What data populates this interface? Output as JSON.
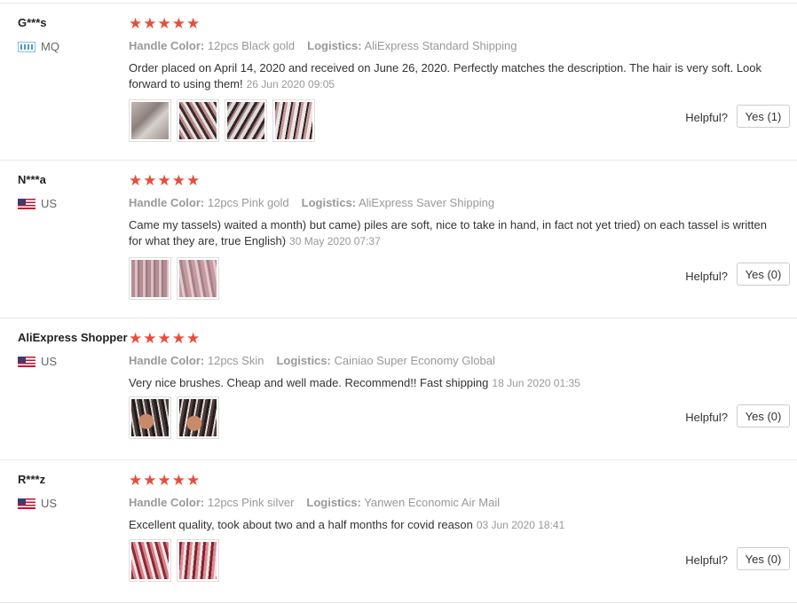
{
  "reviews": [
    {
      "user": "G***s",
      "country": "MQ",
      "rating": 5,
      "attr1_label": "Handle Color:",
      "attr1_value": "12pcs Black gold",
      "attr2_label": "Logistics:",
      "attr2_value": "AliExpress Standard Shipping",
      "text": "Order placed on April 14, 2020 and received on June 26, 2020. Perfectly matches the description. The hair is very soft. Look forward to using them!",
      "date": "26 Jun 2020 09:05",
      "helpful_label": "Helpful?",
      "yes_label": "Yes (1)"
    },
    {
      "user": "N***a",
      "country": "US",
      "rating": 5,
      "attr1_label": "Handle Color:",
      "attr1_value": "12pcs Pink gold",
      "attr2_label": "Logistics:",
      "attr2_value": "AliExpress Saver Shipping",
      "text": "Came my tassels) waited a month) but came) piles are soft, nice to take in hand, in fact not yet tried) on each tassel is written for what they are, true English)",
      "date": "30 May 2020 07:37",
      "helpful_label": "Helpful?",
      "yes_label": "Yes (0)"
    },
    {
      "user": "AliExpress Shopper",
      "country": "US",
      "rating": 5,
      "attr1_label": "Handle Color:",
      "attr1_value": "12pcs Skin",
      "attr2_label": "Logistics:",
      "attr2_value": "Cainiao Super Economy Global",
      "text": "Very nice brushes. Cheap and well made. Recommend!! Fast shipping",
      "date": "18 Jun 2020 01:35",
      "helpful_label": "Helpful?",
      "yes_label": "Yes (0)"
    },
    {
      "user": "R***z",
      "country": "US",
      "rating": 5,
      "attr1_label": "Handle Color:",
      "attr1_value": "12pcs Pink silver",
      "attr2_label": "Logistics:",
      "attr2_value": "Yanwen Economic Air Mail",
      "text": "Excellent quality, took about two and a half months for covid reason",
      "date": "03 Jun 2020 18:41",
      "helpful_label": "Helpful?",
      "yes_label": "Yes (0)"
    }
  ],
  "colors": {
    "star": "#e84c3d",
    "muted": "#999999",
    "border": "#e6e6e6"
  }
}
